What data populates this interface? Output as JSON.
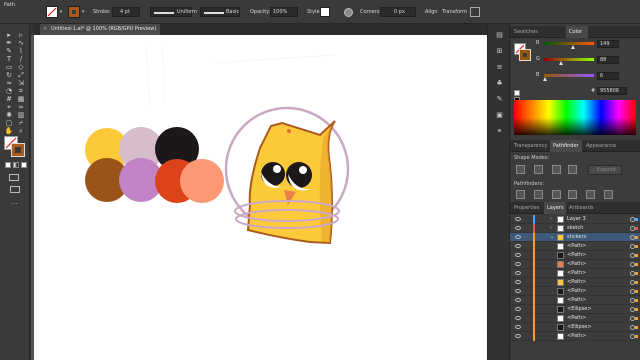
{
  "control_bar": {
    "selection_type": "Path",
    "stroke_label": "Stroke:",
    "stroke_weight": "4 pt",
    "variable_width_profile": "Uniform",
    "brush_definition": "Basic",
    "opacity_label": "Opacity:",
    "opacity_value": "100%",
    "style_label": "Style:",
    "corners_label": "Corners:",
    "corners_value": "0 px",
    "align_label": "Align",
    "transform_label": "Transform"
  },
  "document": {
    "tab_title": "Untitled-1.ai* @ 100% (RGB/GPU Preview)",
    "close_symbol": "×"
  },
  "tools": [
    "selection-tool",
    "direct-selection-tool",
    "pen-tool",
    "curvature-tool",
    "pencil-tool",
    "brush-tool",
    "type-tool",
    "line-tool",
    "rectangle-tool",
    "shaper-tool",
    "rotate-tool",
    "scale-tool",
    "width-tool",
    "free-transform-tool",
    "shape-builder-tool",
    "perspective-tool",
    "mesh-tool",
    "gradient-tool",
    "eyedropper-tool",
    "blend-tool",
    "symbol-sprayer-tool",
    "graph-tool",
    "artboard-tool",
    "slice-tool",
    "hand-tool",
    "zoom-tool"
  ],
  "swatch_circles": [
    "#fcc93a",
    "#d7bccc",
    "#1c1719",
    "#9a5417",
    "#c182c6",
    "#dc431b",
    "#fd9875"
  ],
  "character": {
    "body_color": "#fcc93a",
    "outline_color": "#ab5a1b",
    "helmet_color": "#c9a8c4",
    "beak_color": "#ea7f48"
  },
  "color_panel": {
    "tabs": [
      "Swatches",
      "Color"
    ],
    "active_tab": "Color",
    "channels": [
      {
        "label": "R",
        "value": "149"
      },
      {
        "label": "G",
        "value": "88"
      },
      {
        "label": "B",
        "value": "6"
      }
    ],
    "hex_prefix": "#",
    "hex": "955806"
  },
  "pathfinder_panel": {
    "tabs": [
      "Transparency",
      "Pathfinder",
      "Appearance"
    ],
    "active_tab": "Pathfinder",
    "shape_modes_label": "Shape Modes:",
    "expand_label": "Expand",
    "pathfinders_label": "Pathfinders:"
  },
  "layers_panel": {
    "tabs": [
      "Properties",
      "Layers",
      "Artboards"
    ],
    "active_tab": "Layers",
    "rows": [
      {
        "name": "Layer 3",
        "color": "#4aa3ff",
        "twirl": "›",
        "selected": false,
        "thumb": "#ffffff"
      },
      {
        "name": "sketch",
        "color": "#e05a5a",
        "twirl": "›",
        "selected": false,
        "thumb": "#f4f4f4"
      },
      {
        "name": "stickers",
        "color": "#f0a030",
        "twirl": "⌄",
        "selected": true,
        "thumb": "#fcc93a"
      },
      {
        "name": "<Path>",
        "color": "#f0a030",
        "twirl": "",
        "selected": false,
        "thumb": "#ffffff"
      },
      {
        "name": "<Path>",
        "color": "#f0a030",
        "twirl": "",
        "selected": false,
        "thumb": "#1c1719"
      },
      {
        "name": "<Path>",
        "color": "#f0a030",
        "twirl": "",
        "selected": false,
        "thumb": "#ea7f48"
      },
      {
        "name": "<Path>",
        "color": "#f0a030",
        "twirl": "",
        "selected": false,
        "thumb": "#ffffff"
      },
      {
        "name": "<Path>",
        "color": "#f0a030",
        "twirl": "",
        "selected": false,
        "thumb": "#fcc93a"
      },
      {
        "name": "<Path>",
        "color": "#f0a030",
        "twirl": "",
        "selected": false,
        "thumb": "#1c1719"
      },
      {
        "name": "<Path>",
        "color": "#f0a030",
        "twirl": "",
        "selected": false,
        "thumb": "#ffffff"
      },
      {
        "name": "<Ellipse>",
        "color": "#f0a030",
        "twirl": "",
        "selected": false,
        "thumb": "#1c1719"
      },
      {
        "name": "<Path>",
        "color": "#f0a030",
        "twirl": "",
        "selected": false,
        "thumb": "#ffffff"
      },
      {
        "name": "<Ellipse>",
        "color": "#f0a030",
        "twirl": "",
        "selected": false,
        "thumb": "#1c1719"
      },
      {
        "name": "<Path>",
        "color": "#f0a030",
        "twirl": "",
        "selected": false,
        "thumb": "#ffffff"
      }
    ]
  }
}
